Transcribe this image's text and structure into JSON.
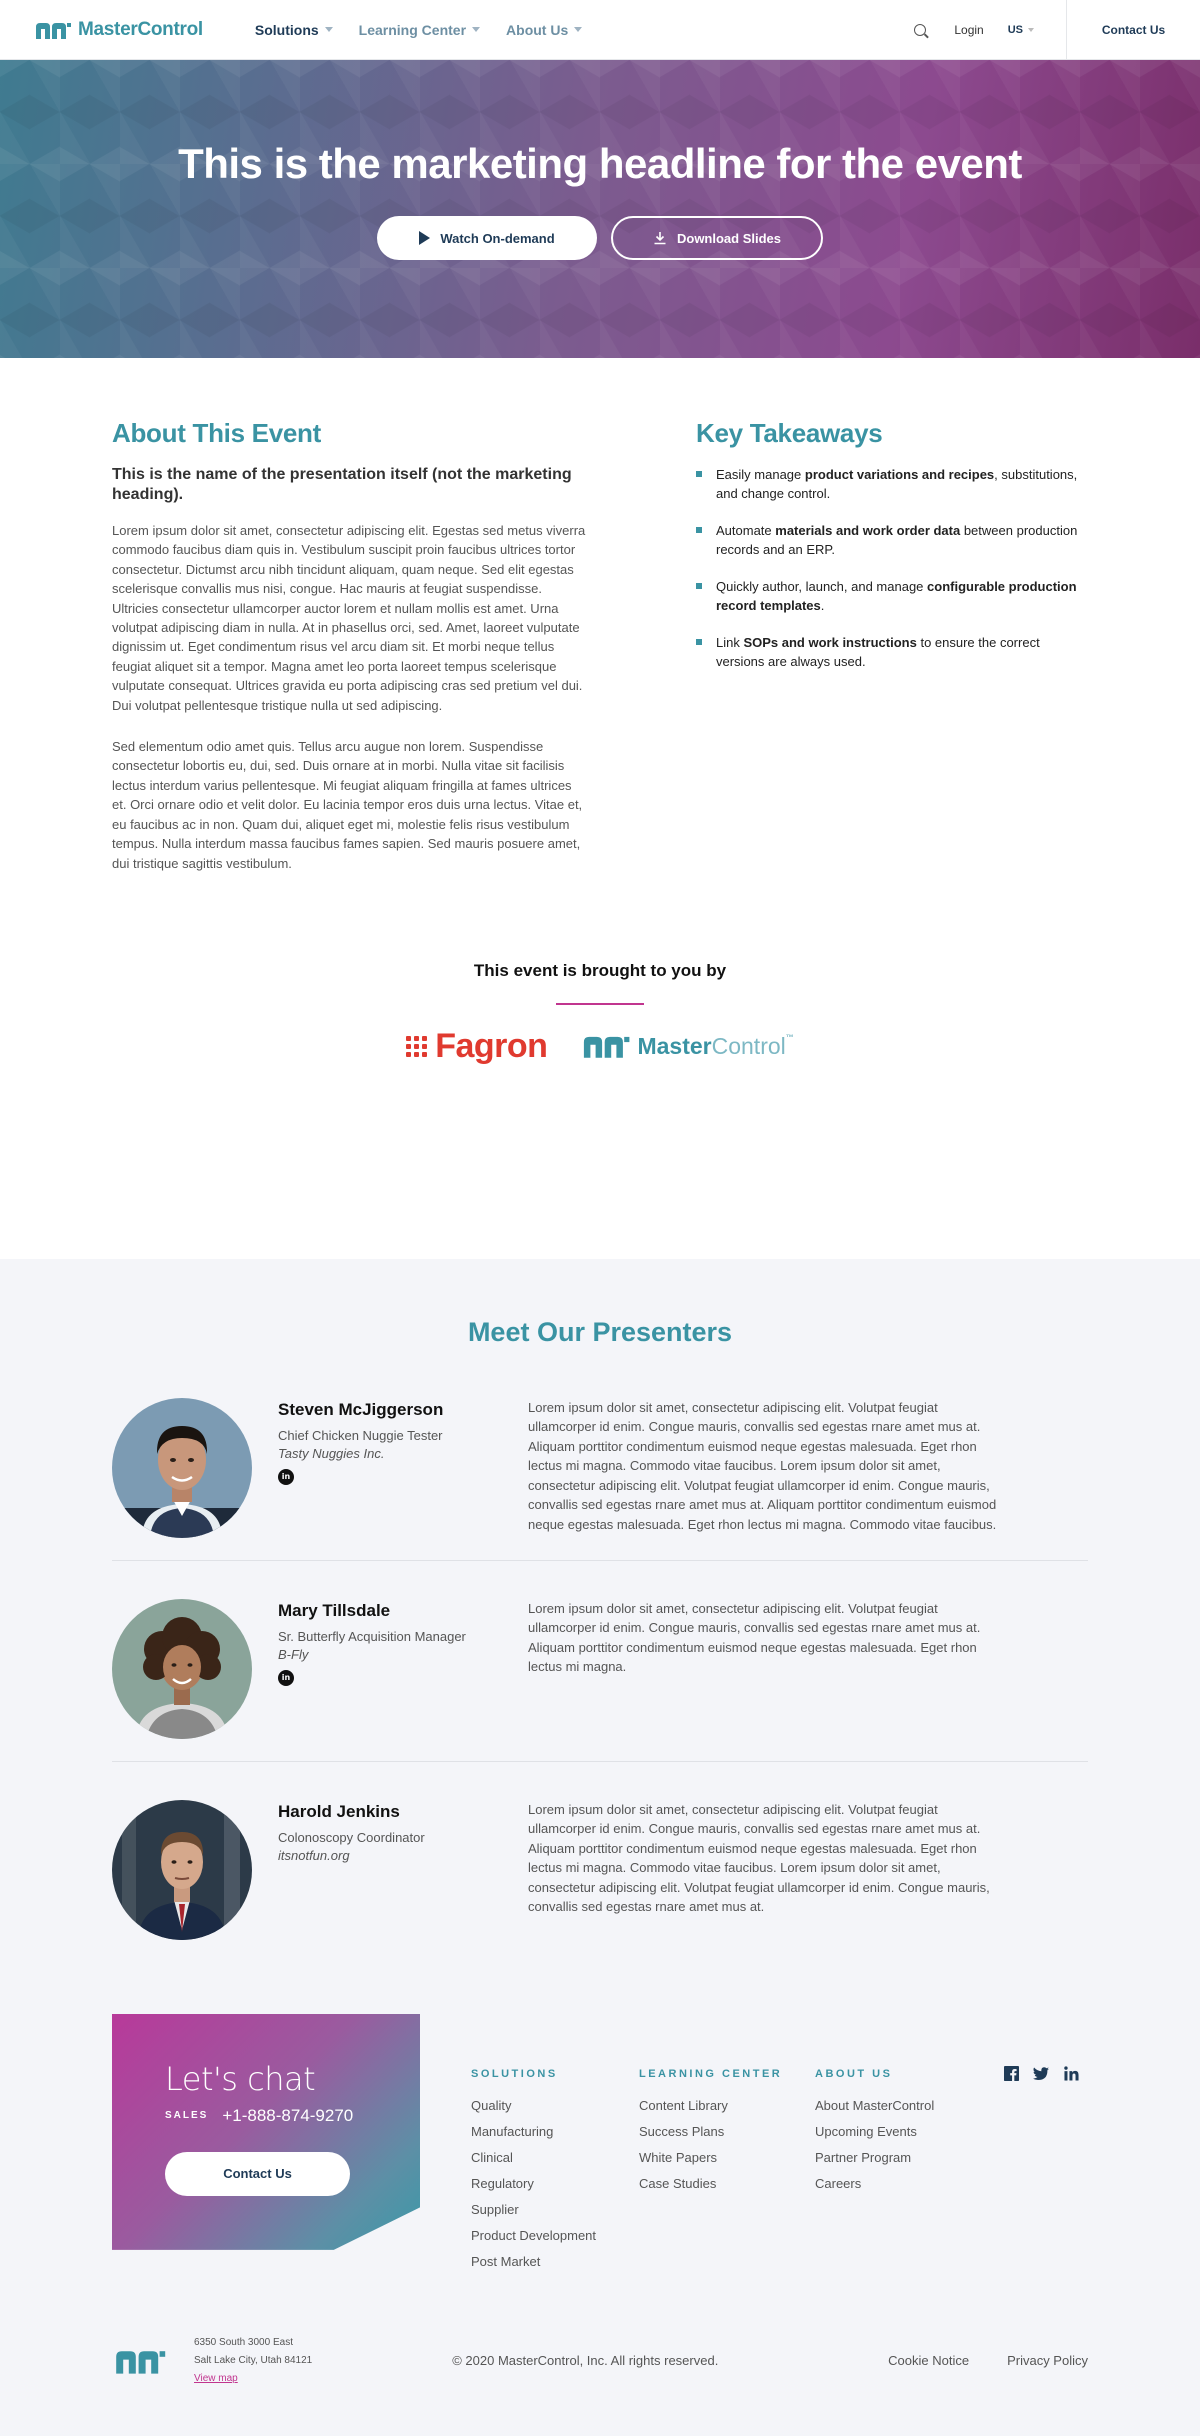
{
  "nav": {
    "logo_text": "MasterControl",
    "links": [
      {
        "label": "Solutions"
      },
      {
        "label": "Learning Center"
      },
      {
        "label": "About Us"
      }
    ],
    "login": "Login",
    "region": "US",
    "contact": "Contact Us"
  },
  "hero": {
    "headline": "This is the marketing headline for the event",
    "watch_label": "Watch On-demand",
    "slides_label": "Download Slides"
  },
  "about": {
    "heading": "About This Event",
    "presentation_name": "This is the name of the presentation itself (not the marketing heading).",
    "paragraphs": [
      "Lorem ipsum dolor sit amet, consectetur adipiscing elit. Egestas sed metus viverra commodo faucibus diam quis in. Vestibulum suscipit proin faucibus ultrices tortor consectetur. Dictumst arcu nibh tincidunt aliquam, quam neque. Sed elit egestas scelerisque convallis mus nisi, congue. Hac mauris at feugiat suspendisse. Ultricies consectetur ullamcorper auctor lorem et nullam mollis est amet. Urna volutpat adipiscing diam in nulla. At in phasellus orci, sed. Amet, laoreet vulputate dignissim ut. Eget condimentum risus vel arcu diam sit. Et morbi neque tellus feugiat aliquet sit a tempor. Magna amet leo porta laoreet tempus scelerisque vulputate consequat. Ultrices gravida eu porta adipiscing cras sed pretium vel dui. Dui volutpat pellentesque tristique nulla ut sed adipiscing.",
      "Sed elementum odio amet quis. Tellus arcu augue non lorem. Suspendisse consectetur lobortis eu, dui, sed. Duis ornare at in morbi. Nulla vitae sit facilisis lectus interdum varius pellentesque. Mi feugiat aliquam fringilla at fames ultrices et. Orci ornare odio et velit dolor. Eu lacinia tempor eros duis urna lectus. Vitae et, eu faucibus ac in non. Quam dui, aliquet eget mi, molestie felis risus vestibulum tempus. Nulla interdum massa faucibus fames sapien. Sed mauris posuere amet, dui tristique sagittis vestibulum."
    ]
  },
  "takeaways": {
    "heading": "Key Takeaways",
    "items": [
      {
        "pre": "Easily manage ",
        "bold": "product variations and recipes",
        "post": ", substitutions, and change control."
      },
      {
        "pre": "Automate ",
        "bold": "materials and work order data",
        "post": " between production records and an ERP."
      },
      {
        "pre": "Quickly author, launch, and manage ",
        "bold": "configurable production record templates",
        "post": "."
      },
      {
        "pre": "Link ",
        "bold": "SOPs and work instructions",
        "post": " to ensure the correct versions are always used."
      }
    ]
  },
  "sponsors": {
    "heading": "This event is brought to you by",
    "fagron": "Fagron",
    "mc_dark": "Master",
    "mc_light": "Control",
    "tm": "™"
  },
  "presenters": {
    "heading": "Meet Our Presenters",
    "items": [
      {
        "name": "Steven McJiggerson",
        "role": "Chief Chicken Nuggie Tester",
        "company": "Tasty Nuggies Inc.",
        "linkedin": "in",
        "bio": "Lorem ipsum dolor sit amet, consectetur adipiscing elit. Volutpat feugiat ullamcorper id enim. Congue mauris, convallis sed egestas rnare amet mus at. Aliquam porttitor condimentum euismod neque egestas malesuada. Eget rhon lectus mi magna. Commodo vitae faucibus. Lorem ipsum dolor sit amet, consectetur adipiscing elit. Volutpat feugiat ullamcorper id enim. Congue mauris, convallis sed egestas rnare amet mus at. Aliquam porttitor condimentum euismod neque egestas malesuada. Eget rhon lectus mi magna. Commodo vitae faucibus."
      },
      {
        "name": "Mary Tillsdale",
        "role": "Sr. Butterfly Acquisition Manager",
        "company": "B-Fly",
        "linkedin": "in",
        "bio": "Lorem ipsum dolor sit amet, consectetur adipiscing elit. Volutpat feugiat ullamcorper id enim. Congue mauris, convallis sed egestas rnare amet mus at. Aliquam porttitor condimentum euismod neque egestas malesuada. Eget rhon lectus mi magna."
      },
      {
        "name": "Harold Jenkins",
        "role": "Colonoscopy Coordinator",
        "company": "itsnotfun.org",
        "bio": "Lorem ipsum dolor sit amet, consectetur adipiscing elit. Volutpat feugiat ullamcorper id enim. Congue mauris, convallis sed egestas rnare amet mus at. Aliquam porttitor condimentum euismod neque egestas malesuada. Eget rhon lectus mi magna. Commodo vitae faucibus. Lorem ipsum dolor sit amet, consectetur adipiscing elit. Volutpat feugiat ullamcorper id enim. Congue mauris, convallis sed egestas rnare amet mus at."
      }
    ]
  },
  "footer": {
    "chat_title": "Let's chat",
    "sales_label": "SALES",
    "phone": "+1-888-874-9270",
    "contact_btn": "Contact Us",
    "columns": [
      {
        "heading": "SOLUTIONS",
        "links": [
          "Quality",
          "Manufacturing",
          "Clinical",
          "Regulatory",
          "Supplier",
          "Product Development",
          "Post Market"
        ]
      },
      {
        "heading": "LEARNING CENTER",
        "links": [
          "Content Library",
          "Success Plans",
          "White Papers",
          "Case Studies"
        ]
      },
      {
        "heading": "ABOUT US",
        "links": [
          "About MasterControl",
          "Upcoming Events",
          "Partner Program",
          "Careers"
        ]
      }
    ],
    "social": {
      "facebook": "f",
      "twitter": "t",
      "linkedin": "in"
    },
    "address_line1": "6350 South 3000 East",
    "address_line2": "Salt Lake City, Utah 84121",
    "view_map": "View map",
    "copyright": "© 2020 MasterControl, Inc. All rights reserved.",
    "cookie": "Cookie Notice",
    "privacy": "Privacy Policy"
  },
  "colors": {
    "brand_teal": "#3a93a3",
    "navy": "#1f3b57",
    "magenta": "#c1358f",
    "fagron_red": "#e03a2f"
  }
}
